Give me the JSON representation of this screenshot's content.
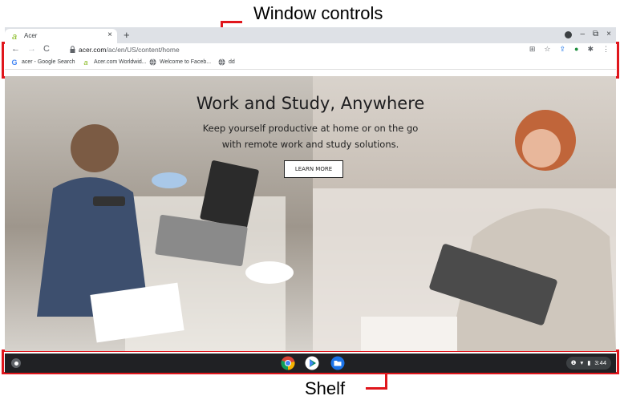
{
  "annotations": {
    "top_label": "Window controls",
    "bottom_label": "Shelf"
  },
  "browser": {
    "tab": {
      "title": "Acer",
      "close_glyph": "×",
      "favicon": "acer-logo-icon"
    },
    "new_tab_glyph": "+",
    "window_controls": {
      "minimize": "–",
      "restore": "⧉",
      "close": "×"
    },
    "toolbar": {
      "back": "←",
      "forward": "→",
      "reload": "C",
      "url_host": "acer.com",
      "url_path": "/ac/en/US/content/home",
      "icons": {
        "translate": "⊞",
        "star": "☆",
        "share": "⇪",
        "profile": "●",
        "extensions": "✱",
        "menu": "⋮"
      }
    },
    "bookmarks": [
      {
        "label": "acer - Google Search",
        "icon": "google-icon"
      },
      {
        "label": "Acer.com Worldwid...",
        "icon": "acer-logo-icon"
      },
      {
        "label": "Welcome to Faceb...",
        "icon": "globe-icon"
      },
      {
        "label": "dd",
        "icon": "globe-icon"
      }
    ]
  },
  "hero": {
    "title": "Work and Study, Anywhere",
    "subtitle_line1": "Keep yourself productive at home or on the go",
    "subtitle_line2": "with remote work and study solutions.",
    "cta": "LEARN MORE"
  },
  "shelf": {
    "apps": [
      "chrome-icon",
      "play-store-icon",
      "files-icon"
    ],
    "status": {
      "notification": "❶",
      "wifi": "▾",
      "battery": "▮",
      "time": "3:44"
    }
  },
  "colors": {
    "annotation": "#e0161c",
    "shelf": "#202124",
    "tabstrip": "#dee1e6"
  }
}
